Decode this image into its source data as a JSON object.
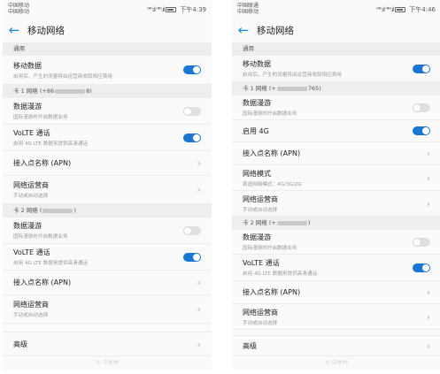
{
  "left": {
    "status": {
      "carrier1": "中国移动",
      "carrier2": "中国移动",
      "signal": "ⁿ⁴ᴳ.ıl ⁿ⁴ᴳ.ıl",
      "time": "下午4:39"
    },
    "title": "移动网络",
    "section_general": "通用",
    "mobile_data": {
      "label": "移动数据",
      "sub": "启用后，产生的流量将由运营商收取相应费用"
    },
    "card1_header": {
      "prefix": "卡 1 网络 (+86",
      "suffix": "8)"
    },
    "c1_roaming": {
      "label": "数据漫游",
      "sub": "国际漫游时开启数据业务"
    },
    "c1_volte": {
      "label": "VoLTE 通话",
      "sub": "启用 4G LTE 数据来提供高清通话"
    },
    "c1_apn": {
      "label": "接入点名称 (APN)"
    },
    "c1_operator": {
      "label": "网络运营商",
      "sub": "手动或自动选择"
    },
    "card2_header": {
      "prefix": "卡 2 网络 (",
      "suffix": ")"
    },
    "c2_roaming": {
      "label": "数据漫游",
      "sub": "国际漫游时开启数据业务"
    },
    "c2_volte": {
      "label": "VoLTE 通话",
      "sub": "启用 4G LTE 数据来提供高清通话"
    },
    "c2_apn": {
      "label": "接入点名称 (APN)"
    },
    "c2_operator": {
      "label": "网络运营商",
      "sub": "手动或自动选择"
    },
    "advanced": {
      "label": "高级"
    },
    "watermark": "© 中关村"
  },
  "right": {
    "status": {
      "carrier1": "中国联通",
      "carrier2": "中国移动",
      "signal": "ⁿ⁴ᴳ.ıl ⁿ⁴ᴳ.ıl",
      "time": "下午4:46"
    },
    "title": "移动网络",
    "section_general": "通用",
    "mobile_data": {
      "label": "移动数据",
      "sub": "启用后，产生的流量将由运营商收取相应费用"
    },
    "card1_header": {
      "prefix": "卡 1 网络 (+",
      "suffix": "765)"
    },
    "c1_roaming": {
      "label": "数据漫游",
      "sub": "国际漫游时开启数据业务"
    },
    "c1_4g": {
      "label": "启用 4G"
    },
    "c1_apn": {
      "label": "接入点名称 (APN)"
    },
    "c1_mode": {
      "label": "网络模式",
      "sub": "首选网络模式：4G/3G/2G"
    },
    "c1_operator": {
      "label": "网络运营商",
      "sub": "手动或自动选择"
    },
    "card2_header": {
      "prefix": "卡 2 网络 (+",
      "suffix": ")"
    },
    "c2_roaming": {
      "label": "数据漫游",
      "sub": "国际漫游时开启数据业务"
    },
    "c2_volte": {
      "label": "VoLTE 通话",
      "sub": "启用 4G LTE 数据来提供高清通话"
    },
    "c2_apn": {
      "label": "接入点名称 (APN)"
    },
    "c2_operator": {
      "label": "网络运营商",
      "sub": "手动或自动选择"
    },
    "advanced": {
      "label": "高级"
    },
    "watermark": "© 中关村"
  },
  "colors": {
    "accent": "#1976d2",
    "toggle_off": "#e0e0e0",
    "section_bg": "#eeeeee"
  }
}
